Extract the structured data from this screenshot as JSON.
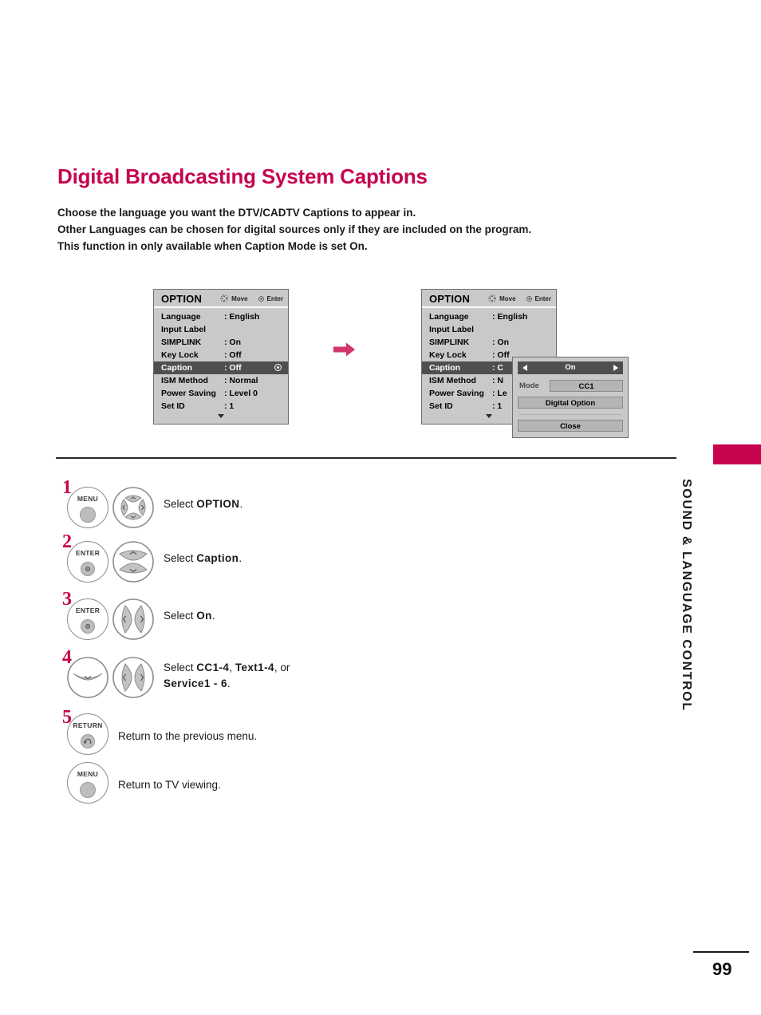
{
  "page": {
    "title": "Digital Broadcasting System Captions",
    "number": "99",
    "side_label": "SOUND & LANGUAGE CONTROL",
    "accent_color": "#c6044f"
  },
  "intro": {
    "line1": "Choose the language you want the DTV/CADTV Captions to appear in.",
    "line2": "Other Languages can be chosen for digital sources only if they are included on the program.",
    "line3_a": "This function in only available when ",
    "line3_b": "Caption",
    "line3_c": " Mode is set ",
    "line3_d": "On",
    "line3_e": "."
  },
  "osd": {
    "title": "OPTION",
    "hint_move": "Move",
    "hint_enter": "Enter",
    "rows": [
      {
        "label": "Language",
        "value": ": English"
      },
      {
        "label": "Input Label",
        "value": ""
      },
      {
        "label": "SIMPLINK",
        "value": ": On"
      },
      {
        "label": "Key Lock",
        "value": ": Off"
      },
      {
        "label": "Caption",
        "value": ": Off"
      },
      {
        "label": "ISM Method",
        "value": ": Normal"
      },
      {
        "label": "Power Saving",
        "value": ": Level 0"
      },
      {
        "label": "Set ID",
        "value": ": 1"
      }
    ],
    "rows_2": [
      {
        "label": "Language",
        "value": ": English"
      },
      {
        "label": "Input Label",
        "value": ""
      },
      {
        "label": "SIMPLINK",
        "value": ": On"
      },
      {
        "label": "Key Lock",
        "value": ": Off"
      },
      {
        "label": "Caption",
        "value": ": C"
      },
      {
        "label": "ISM Method",
        "value": ": N"
      },
      {
        "label": "Power Saving",
        "value": ": Le"
      },
      {
        "label": "Set ID",
        "value": ": 1"
      }
    ]
  },
  "popup": {
    "state": "On",
    "mode_label": "Mode",
    "mode_value": "CC1",
    "digital_option": "Digital Option",
    "close": "Close"
  },
  "steps": [
    {
      "num": "1",
      "button": "MENU",
      "text_a": "Select ",
      "text_b": "OPTION",
      "text_c": "."
    },
    {
      "num": "2",
      "button": "ENTER",
      "text_a": "Select ",
      "text_b": "Caption",
      "text_c": "."
    },
    {
      "num": "3",
      "button": "ENTER",
      "text_a": "Select ",
      "text_b": "On",
      "text_c": "."
    },
    {
      "num": "4",
      "button": "",
      "text_a": "Select ",
      "text_b": "CC1-4",
      "text_c": ", ",
      "text_d": "Text1-4",
      "text_e": ", or",
      "text_f": "Service1 - 6",
      "text_g": "."
    },
    {
      "num": "5",
      "button": "RETURN",
      "text_a": "Return to the previous menu."
    }
  ],
  "final_step": {
    "button": "MENU",
    "text": "Return to TV viewing."
  }
}
